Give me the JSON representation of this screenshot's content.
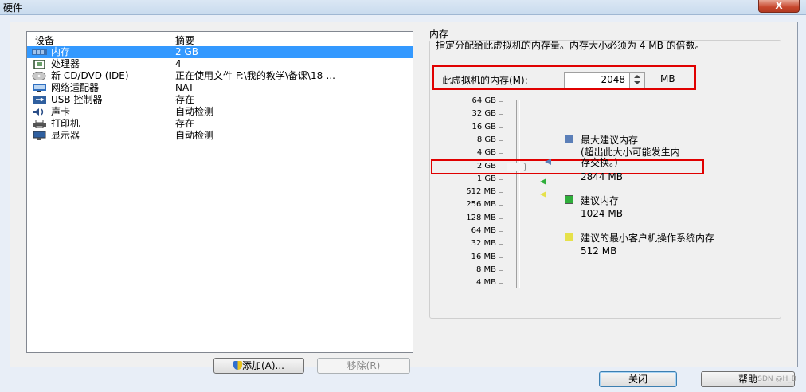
{
  "window": {
    "title": "硬件",
    "close_glyph": "X"
  },
  "device_list": {
    "col_device": "设备",
    "col_summary": "摘要",
    "rows": [
      {
        "name": "内存",
        "summary": "2 GB",
        "icon": "memory-icon",
        "selected": true
      },
      {
        "name": "处理器",
        "summary": "4",
        "icon": "processor-icon"
      },
      {
        "name": "新 CD/DVD (IDE)",
        "summary": "正在使用文件 F:\\我的教学\\备课\\18-...",
        "icon": "cd-dvd-icon"
      },
      {
        "name": "网络适配器",
        "summary": "NAT",
        "icon": "network-adapter-icon"
      },
      {
        "name": "USB 控制器",
        "summary": "存在",
        "icon": "usb-controller-icon"
      },
      {
        "name": "声卡",
        "summary": "自动检测",
        "icon": "sound-card-icon"
      },
      {
        "name": "打印机",
        "summary": "存在",
        "icon": "printer-icon"
      },
      {
        "name": "显示器",
        "summary": "自动检测",
        "icon": "display-icon"
      }
    ]
  },
  "buttons": {
    "add": "添加(A)...",
    "remove": "移除(R)",
    "close": "关闭",
    "help": "帮助"
  },
  "memory": {
    "group_label": "内存",
    "description": "指定分配给此虚拟机的内存量。内存大小必须为 4 MB 的倍数。",
    "field_label": "此虚拟机的内存(M):",
    "value": "2048",
    "unit": "MB",
    "slider_value": "2 GB",
    "ticks": [
      "64 GB",
      "32 GB",
      "16 GB",
      "8 GB",
      "4 GB",
      "2 GB",
      "1 GB",
      "512 MB",
      "256 MB",
      "128 MB",
      "64 MB",
      "32 MB",
      "16 MB",
      "8 MB",
      "4 MB"
    ],
    "legend": {
      "max_title": "最大建议内存",
      "max_note": "(超出此大小可能发生内存交换。)",
      "max_value": "2844 MB",
      "rec_title": "建议内存",
      "rec_value": "1024 MB",
      "min_title": "建议的最小客户机操作系统内存",
      "min_value": "512 MB"
    },
    "colors": {
      "max": "#5b7fb8",
      "rec": "#2fae3b",
      "min": "#e6e14a",
      "highlight": "#e00000"
    }
  },
  "watermark": "CSDN @H_B"
}
